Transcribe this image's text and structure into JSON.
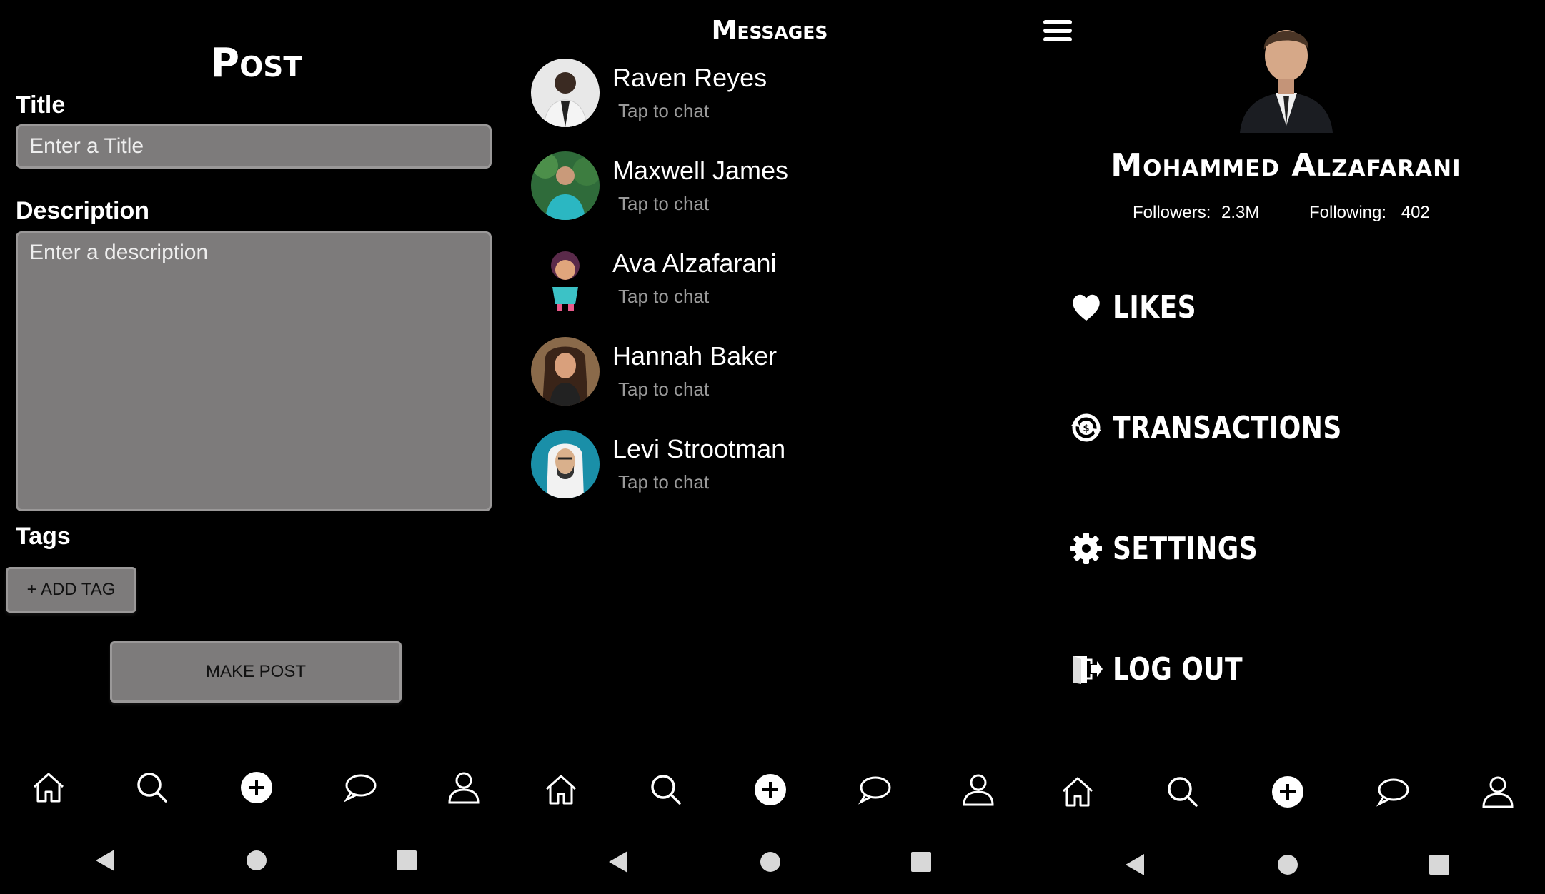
{
  "post": {
    "title": "Post",
    "title_label": "Title",
    "title_placeholder": "Enter a Title",
    "description_label": "Description",
    "description_placeholder": "Enter a description",
    "tags_label": "Tags",
    "add_tag_label": "+ ADD TAG",
    "make_post_label": "MAKE POST"
  },
  "messages": {
    "title": "Messages",
    "chats": [
      {
        "name": "Raven Reyes",
        "subtitle": "Tap to chat"
      },
      {
        "name": "Maxwell James",
        "subtitle": "Tap to chat"
      },
      {
        "name": "Ava Alzafarani",
        "subtitle": "Tap to chat"
      },
      {
        "name": "Hannah Baker",
        "subtitle": "Tap to chat"
      },
      {
        "name": "Levi Strootman",
        "subtitle": "Tap to chat"
      }
    ]
  },
  "profile": {
    "name": "Mohammed Alzafarani",
    "followers_label": "Followers:",
    "followers_value": "2.3M",
    "following_label": "Following:",
    "following_value": "402",
    "menu": [
      {
        "label": "LIKES",
        "icon": "heart-icon"
      },
      {
        "label": "TRANSACTIONS",
        "icon": "transactions-icon"
      },
      {
        "label": "SETTINGS",
        "icon": "gear-icon"
      },
      {
        "label": "LOG OUT",
        "icon": "logout-icon"
      }
    ]
  },
  "bottom_nav": [
    "home-icon",
    "search-icon",
    "add-circle-icon",
    "chat-bubble-icon",
    "user-icon"
  ],
  "system_nav": [
    "back-triangle-icon",
    "home-circle-icon",
    "recents-square-icon"
  ],
  "colors": {
    "background": "#000000",
    "field_fill": "#7d7b7b",
    "field_border": "#9a9898",
    "subtitle_text": "#9a9a9a",
    "text": "#ffffff"
  }
}
